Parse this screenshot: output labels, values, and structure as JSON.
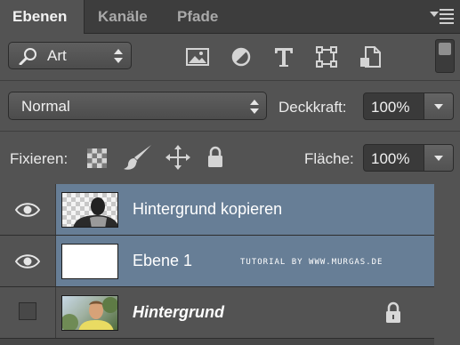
{
  "tabs": [
    {
      "label": "Ebenen",
      "active": true
    },
    {
      "label": "Kanäle",
      "active": false
    },
    {
      "label": "Pfade",
      "active": false
    }
  ],
  "filter": {
    "label": "Art",
    "icons": [
      "image-filter-icon",
      "adjustment-filter-icon",
      "type-filter-icon",
      "shape-filter-icon",
      "smart-object-filter-icon"
    ]
  },
  "blend": {
    "mode": "Normal",
    "opacity_label": "Deckkraft:",
    "opacity_value": "100%"
  },
  "lock": {
    "label": "Fixieren:",
    "fill_label": "Fläche:",
    "fill_value": "100%"
  },
  "layers": [
    {
      "name": "Hintergrund kopieren",
      "visible": true,
      "selected": true
    },
    {
      "name": "Ebene 1",
      "visible": true,
      "selected": true,
      "overlay_text": "TUTORIAL BY WWW.MURGAS.DE"
    },
    {
      "name": "Hintergrund",
      "visible": false,
      "selected": false,
      "locked": true
    }
  ],
  "colors": {
    "panel": "#535353",
    "selection": "#677e96",
    "tabbar": "#3d3d3d"
  }
}
